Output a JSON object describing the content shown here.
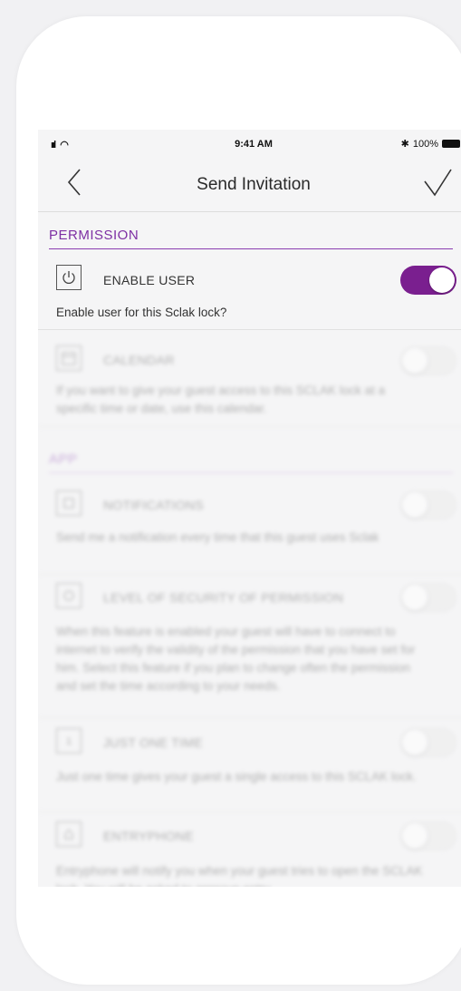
{
  "status_bar": {
    "signal": "ıııl",
    "wifi": "◠",
    "time": "9:41 AM",
    "bluetooth": "✱",
    "battery": "100%"
  },
  "nav": {
    "title": "Send Invitation",
    "back_icon": "chevron-left-icon",
    "done_icon": "checkmark-icon"
  },
  "permission_section": {
    "header": "PERMISSION",
    "enable_user": {
      "label": "ENABLE USER",
      "icon": "power-icon",
      "toggle_on": true,
      "description": "Enable user for this Sclak lock?"
    },
    "calendar": {
      "label": "CALENDAR",
      "icon": "calendar-icon",
      "toggle_on": false,
      "description": "If you want to give your guest access to this SCLAK lock at a specific time or date, use this calendar."
    }
  },
  "app_section": {
    "header": "APP",
    "items": [
      {
        "label": "NOTIFICATIONS",
        "icon": "notification-icon",
        "toggle_on": false,
        "description": "Send me a notification every time that this guest uses Sclak"
      },
      {
        "label": "LEVEL OF SECURITY OF PERMISSION",
        "icon": "security-icon",
        "toggle_on": false,
        "description": "When this feature is enabled your guest will have to connect to internet to verify the validity of the permission that you have set for him. Select this feature if you plan to change often the permission and set the time according to your needs."
      },
      {
        "label": "JUST ONE TIME",
        "icon": "one-time-icon",
        "toggle_on": false,
        "description": "Just one time gives your guest a single access to this SCLAK lock."
      },
      {
        "label": "ENTRYPHONE",
        "icon": "entryphone-icon",
        "toggle_on": false,
        "description": "Entryphone will notify you when your guest tries to open the SCLAK lock. You will be asked to approve entry."
      }
    ]
  },
  "colors": {
    "accent": "#7a1f8f",
    "section_header": "#7d2fa3",
    "screen_bg": "#f5f5f6"
  }
}
